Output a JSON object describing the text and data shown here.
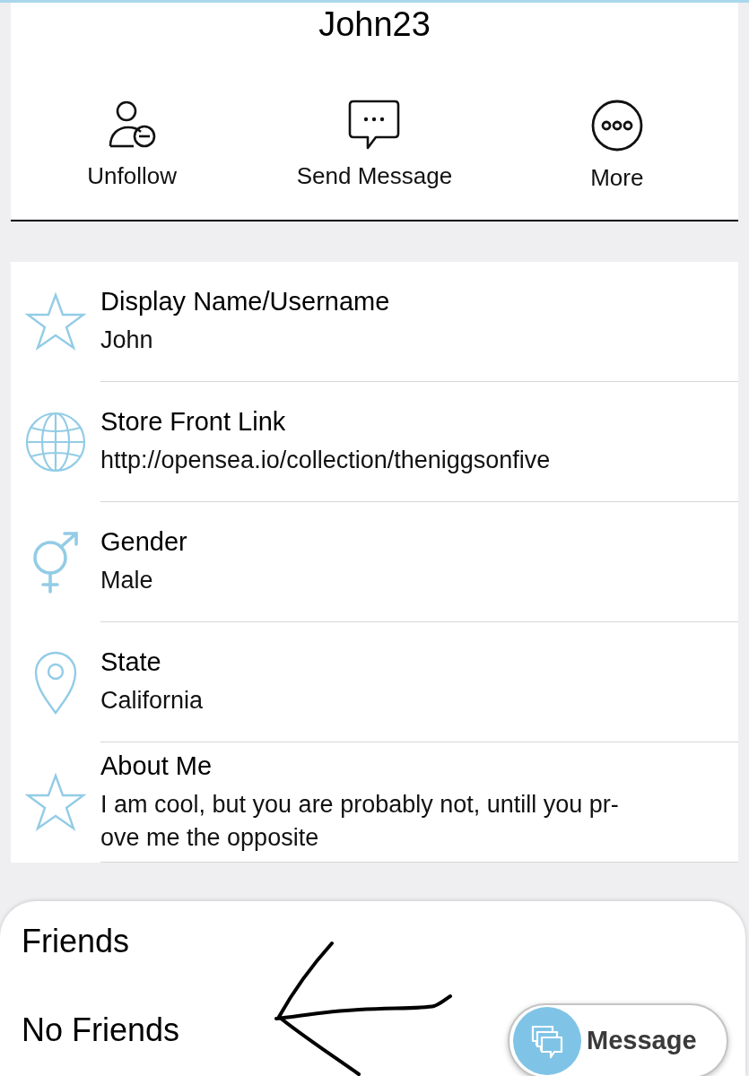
{
  "header": {
    "title": "John23"
  },
  "actions": [
    {
      "kind": "unfollow",
      "label": "Unfollow"
    },
    {
      "kind": "message",
      "label": "Send Message"
    },
    {
      "kind": "more",
      "label": "More"
    }
  ],
  "profile_fields": [
    {
      "kind": "name",
      "label": "Display Name/Username",
      "value": "John"
    },
    {
      "kind": "link",
      "label": "Store Front Link",
      "value": "http://opensea.io/collection/theniggsonfive"
    },
    {
      "kind": "gender",
      "label": "Gender",
      "value": "Male"
    },
    {
      "kind": "location",
      "label": "State",
      "value": "California"
    },
    {
      "kind": "about",
      "label": "About Me",
      "value": "I am cool, but you are probably not, untill you pr-\nove me the opposite"
    }
  ],
  "friends": {
    "title": "Friends",
    "empty_text": "No Friends"
  },
  "message_button": {
    "label": "Message"
  }
}
